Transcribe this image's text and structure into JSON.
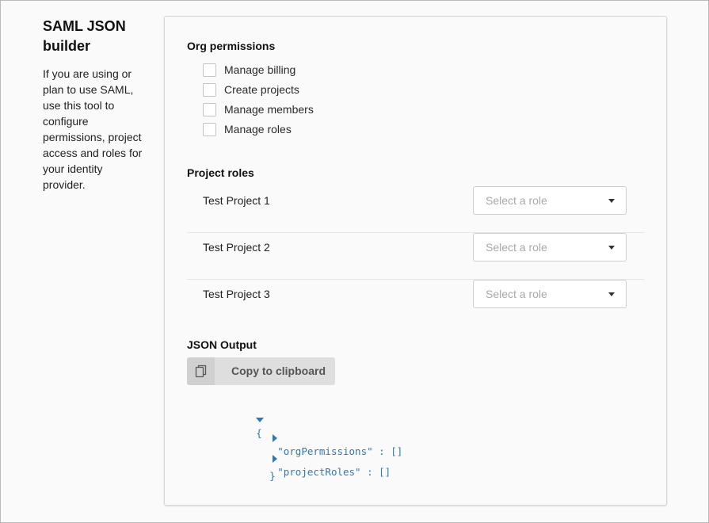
{
  "sidebar": {
    "title": "SAML JSON builder",
    "description": "If you are using or plan to use SAML, use this tool to configure permissions, project access and roles for your identity provider."
  },
  "org_permissions": {
    "title": "Org permissions",
    "items": [
      {
        "label": "Manage billing",
        "checked": false
      },
      {
        "label": "Create projects",
        "checked": false
      },
      {
        "label": "Manage members",
        "checked": false
      },
      {
        "label": "Manage roles",
        "checked": false
      }
    ]
  },
  "project_roles": {
    "title": "Project roles",
    "placeholder": "Select a role",
    "projects": [
      {
        "name": "Test Project 1"
      },
      {
        "name": "Test Project 2"
      },
      {
        "name": "Test Project 3"
      }
    ]
  },
  "json_output": {
    "title": "JSON Output",
    "copy_label": "Copy to clipboard",
    "open_brace": "{",
    "close_brace": "}",
    "keys": [
      {
        "key": "\"orgPermissions\"",
        "sep": " : ",
        "value": "[]"
      },
      {
        "key": "\"projectRoles\"",
        "sep": " : ",
        "value": "[]"
      }
    ]
  },
  "colors": {
    "json_blue": "#2f78b5",
    "button_bg": "#dedede",
    "placeholder": "#a9a9a9"
  },
  "icons": {
    "copy": "copy-icon",
    "select_caret": "chevron-down-icon",
    "expand": "expand-triangle-icon",
    "collapse": "collapse-triangle-icon"
  }
}
